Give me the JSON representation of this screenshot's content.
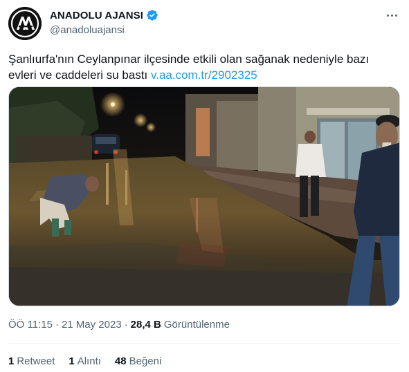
{
  "author": {
    "display_name": "ANADOLU AJANSI",
    "handle": "@anadoluajansi",
    "avatar_icon": "aa-logo-icon",
    "verified_icon": "verified-badge-icon",
    "verified_color": "#1d9bf0",
    "more_icon": "more-dots-icon"
  },
  "tweet": {
    "text": "Şanlıurfa'nın Ceylanpınar ilçesinde etkili olan sağanak nedeniyle bazı evleri ve caddeleri su bastı ",
    "link": "v.aa.com.tr/2902325",
    "link_color": "#1d9bf0"
  },
  "media": {
    "description_icon": "flooded-street-photo"
  },
  "meta": {
    "time": "ÖÖ 11:15",
    "separator": "·",
    "date": "21 May 2023",
    "views_count": "28,4 B",
    "views_label": "Görüntülenme"
  },
  "stats": [
    {
      "count": "1",
      "label": "Retweet"
    },
    {
      "count": "1",
      "label": "Alıntı"
    },
    {
      "count": "48",
      "label": "Beğeni"
    }
  ]
}
